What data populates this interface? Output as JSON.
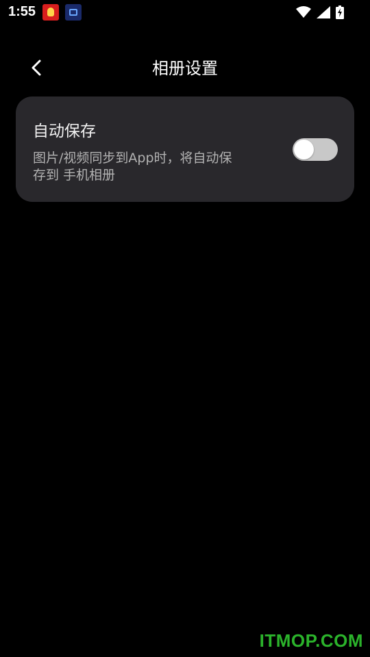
{
  "status_bar": {
    "time": "1:55",
    "icons": [
      "app-notification-icon",
      "app-notification-icon-2",
      "wifi-icon",
      "signal-icon",
      "battery-charging-icon"
    ]
  },
  "header": {
    "title": "相册设置",
    "back_icon": "chevron-left-icon"
  },
  "settings": {
    "auto_save": {
      "title": "自动保存",
      "description_line1": "图片/视频同步到App时，将自动保",
      "description_line2": "存到 手机相册",
      "enabled": false
    }
  },
  "watermark": "ITMOP.COM",
  "colors": {
    "background": "#000000",
    "card": "#29282c",
    "toggle_off": "#c8c8c8",
    "watermark": "#2bb32b"
  }
}
